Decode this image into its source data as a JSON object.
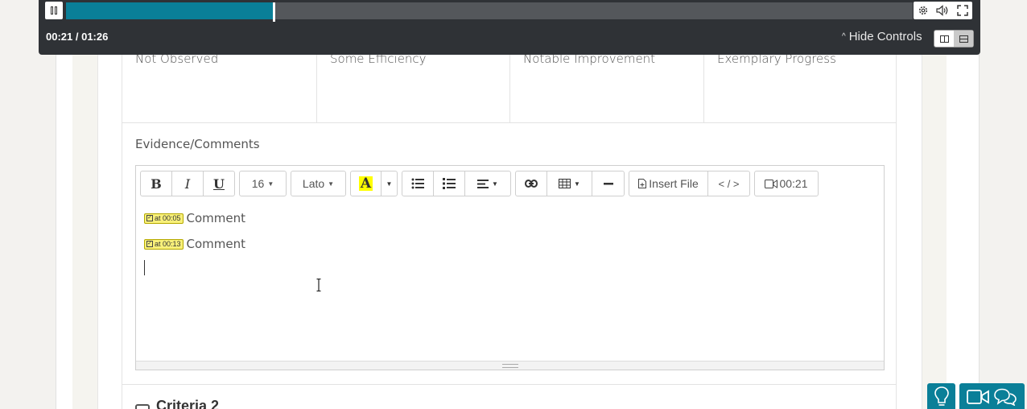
{
  "player": {
    "current_time": "00:21",
    "duration": "01:26",
    "time_readout": "00:21 / 01:26",
    "progress_fraction": 0.2442,
    "hide_controls_label": "Hide Controls",
    "accent_color": "#0a7f98",
    "icons": [
      "pause-icon",
      "settings-icon",
      "volume-icon",
      "fullscreen-icon",
      "split-layout-icon",
      "stacked-layout-icon"
    ]
  },
  "rating_scale": {
    "levels": [
      "Not Observed",
      "Some Efficiency",
      "Notable Improvement",
      "Exemplary Progress"
    ]
  },
  "evidence": {
    "title": "Evidence/Comments",
    "toolbar": {
      "bold": "B",
      "italic": "I",
      "underline": "U",
      "font_size": "16",
      "font_family": "Lato",
      "highlight_letter": "A",
      "insert_file": "Insert File",
      "code_view": "< / >",
      "timestamp": "00:21"
    },
    "comments": [
      {
        "timestamp": "at 00:05",
        "text": "Comment"
      },
      {
        "timestamp": "at 00:13",
        "text": "Comment"
      }
    ]
  },
  "next_section": {
    "title": "Criteria 2"
  },
  "floating": {
    "help_icon": "lightbulb-icon",
    "video_icon": "video-camera-icon",
    "chat_icon": "chat-bubbles-icon"
  }
}
